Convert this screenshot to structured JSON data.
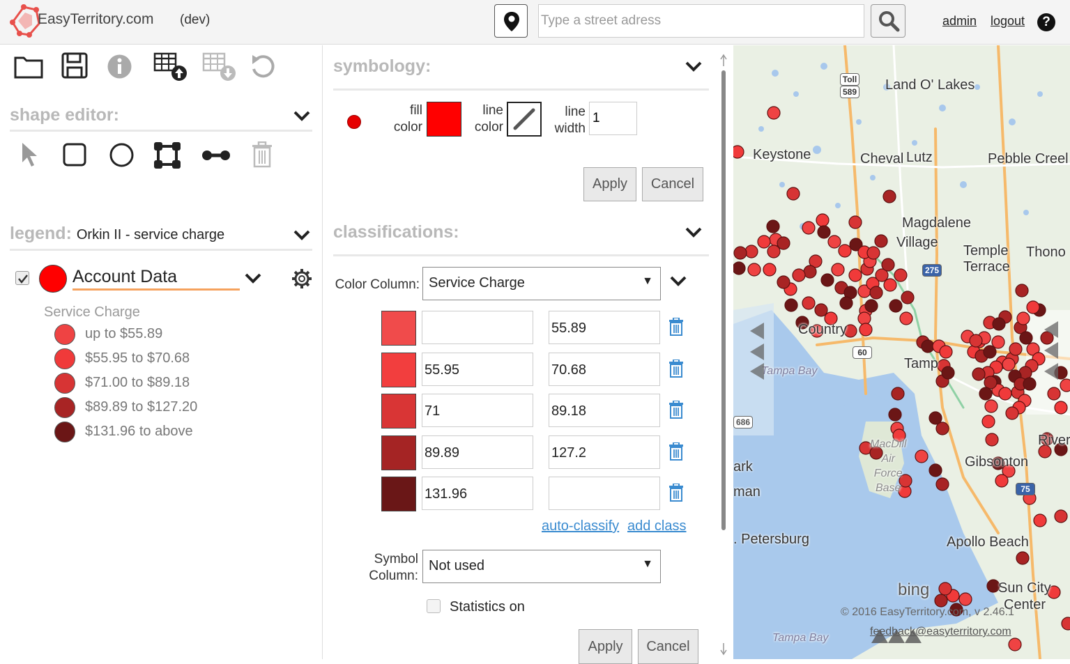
{
  "header": {
    "brand": "EasyTerritory.com",
    "env": "(dev)",
    "address_placeholder": "Type a street adress",
    "admin": "admin",
    "logout": "logout",
    "help": "?"
  },
  "left": {
    "shape_editor_title": "shape editor:",
    "legend_title": "legend:",
    "legend_subtitle": "Orkin II - service charge",
    "layer_name": "Account Data",
    "legend_column": "Service Charge",
    "legend_items": [
      {
        "label": "up to $55.89",
        "color": "#ef4343"
      },
      {
        "label": "$55.95 to $70.68",
        "color": "#f03a3a"
      },
      {
        "label": "$71.00 to $89.18",
        "color": "#d73434"
      },
      {
        "label": "$89.89 to $127.20",
        "color": "#a82424"
      },
      {
        "label": "$131.96 to above",
        "color": "#6b1616"
      }
    ]
  },
  "symbology": {
    "title": "symbology:",
    "fill_label_1": "fill",
    "fill_label_2": "color",
    "line_label_1": "line",
    "line_label_2": "color",
    "width_label_1": "line",
    "width_label_2": "width",
    "line_width": "1",
    "apply": "Apply",
    "cancel": "Cancel",
    "fill_color": "#ff0000"
  },
  "classifications": {
    "title": "classifications:",
    "color_column_label": "Color Column:",
    "color_column_value": "Service Charge",
    "rows": [
      {
        "color": "#f04b4b",
        "min": "",
        "max": "55.89"
      },
      {
        "color": "#f23e3e",
        "min": "55.95",
        "max": "70.68"
      },
      {
        "color": "#d93535",
        "min": "71",
        "max": "89.18"
      },
      {
        "color": "#a52424",
        "min": "89.89",
        "max": "127.2"
      },
      {
        "color": "#6a1717",
        "min": "131.96",
        "max": ""
      }
    ],
    "auto_classify": "auto-classify",
    "add_class": "add class",
    "symbol_column_label_1": "Symbol",
    "symbol_column_label_2": "Column:",
    "symbol_column_value": "Not used",
    "statistics_label": "Statistics on",
    "apply": "Apply",
    "cancel": "Cancel"
  },
  "map": {
    "labels": {
      "land_o_lakes": "Land O' Lakes",
      "keystone": "Keystone",
      "cheval": "Cheval",
      "lutz": "Lutz",
      "pebble_creek": "Pebble Creel",
      "magdalene": "Magdalene",
      "village": "Village",
      "temple": "Temple",
      "terrace": "Terrace",
      "thono": "Thono",
      "country": "Country",
      "tampa": "Tamp",
      "tampa_bay_top": "Tampa Bay",
      "macdill": "MacDill",
      "air": "Air",
      "force": "Force",
      "base": "Base",
      "riverview": "Rivervie",
      "gibsonton": "Gibsonton",
      "park": "ark",
      "man": "man",
      "st_petersburg": ". Petersburg",
      "apollo_beach": "Apollo Beach",
      "sun_city": "Sun City",
      "center": "Center",
      "tampa_bay_bottom": "Tampa Bay",
      "bing": "bing",
      "copyright": "© 2016 EasyTerritory.com, v 2.46.1",
      "feedback": "feedback@easyterritory.com"
    },
    "shields": {
      "toll": "Toll",
      "s589": "589",
      "s275": "275",
      "s60": "60",
      "s686": "686",
      "s75": "75"
    }
  }
}
